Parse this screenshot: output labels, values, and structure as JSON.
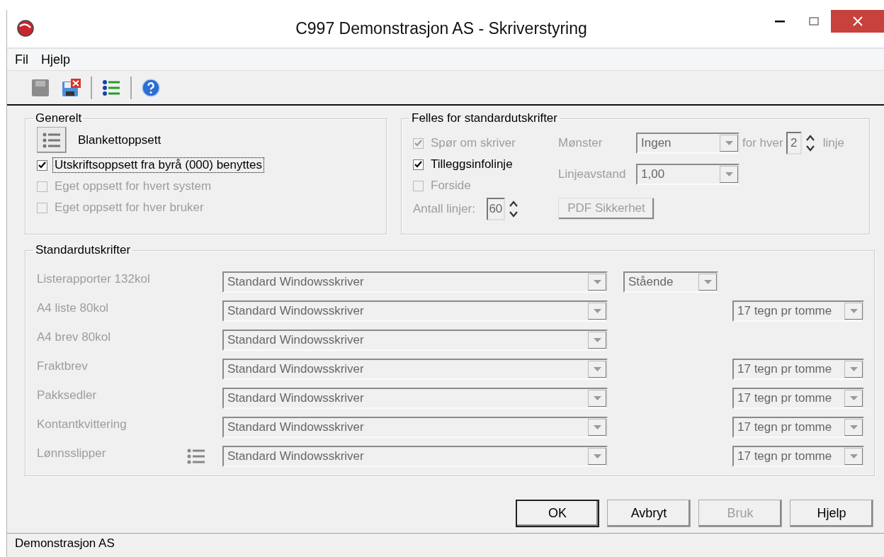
{
  "window": {
    "title": "C997 Demonstrasjon AS - Skriverstyring"
  },
  "menu": [
    "Fil",
    "Hjelp"
  ],
  "toolbar": [
    {
      "kind": "save",
      "disabled": true
    },
    {
      "kind": "discard",
      "disabled": false
    },
    {
      "kind": "separator"
    },
    {
      "kind": "list",
      "disabled": false
    },
    {
      "kind": "separator"
    },
    {
      "kind": "help",
      "disabled": false
    }
  ],
  "general": {
    "title": "Generelt",
    "form_setup_label": "Blankettoppsett",
    "checkboxes": [
      {
        "label": "Utskriftsoppsett fra byrå (000) benyttes",
        "checked": true,
        "disabled": false,
        "focused": true
      },
      {
        "label": "Eget oppsett for hvert system",
        "checked": false,
        "disabled": true,
        "focused": false
      },
      {
        "label": "Eget oppsett for hver bruker",
        "checked": false,
        "disabled": true,
        "focused": false
      }
    ]
  },
  "common": {
    "title": "Felles for standardutskrifter",
    "checkboxes": [
      {
        "label": "Spør om skriver",
        "checked": true,
        "disabled": true
      },
      {
        "label": "Tilleggsinfolinje",
        "checked": true,
        "disabled": false
      },
      {
        "label": "Forside",
        "checked": false,
        "disabled": true
      }
    ],
    "line_count": {
      "label": "Antall linjer:",
      "value": "60"
    },
    "pattern": {
      "label": "Mønster",
      "value": "Ingen",
      "every_label": "for hver",
      "every_value": "2",
      "unit": "linje"
    },
    "line_spacing": {
      "label": "Linjeavstand",
      "value": "1,00"
    },
    "pdf_button": {
      "label": "PDF Sikkerhet",
      "disabled": true
    }
  },
  "printers": {
    "title": "Standardutskrifter",
    "rows": [
      {
        "label": "Listerapporter 132kol",
        "printer": "Standard Windowsskriver",
        "orientation": "Stående",
        "setup_button": false
      },
      {
        "label": "A4 liste 80kol",
        "printer": "Standard Windowsskriver",
        "pitch": "17 tegn pr tomme",
        "setup_button": false
      },
      {
        "label": "A4 brev 80kol",
        "printer": "Standard Windowsskriver",
        "setup_button": false
      },
      {
        "label": "Fraktbrev",
        "printer": "Standard Windowsskriver",
        "pitch": "17 tegn pr tomme",
        "setup_button": false
      },
      {
        "label": "Pakksedler",
        "printer": "Standard Windowsskriver",
        "pitch": "17 tegn pr tomme",
        "setup_button": false
      },
      {
        "label": "Kontantkvittering",
        "printer": "Standard Windowsskriver",
        "pitch": "17 tegn pr tomme",
        "setup_button": false
      },
      {
        "label": "Lønnsslipper",
        "printer": "Standard Windowsskriver",
        "pitch": "17 tegn pr tomme",
        "setup_button": true
      }
    ]
  },
  "buttons": [
    {
      "label": "OK",
      "disabled": false,
      "default": true
    },
    {
      "label": "Avbryt",
      "disabled": false,
      "default": false
    },
    {
      "label": "Bruk",
      "disabled": true,
      "default": false
    },
    {
      "label": "Hjelp",
      "disabled": false,
      "default": false
    }
  ],
  "status_bar": "Demonstrasjon AS"
}
